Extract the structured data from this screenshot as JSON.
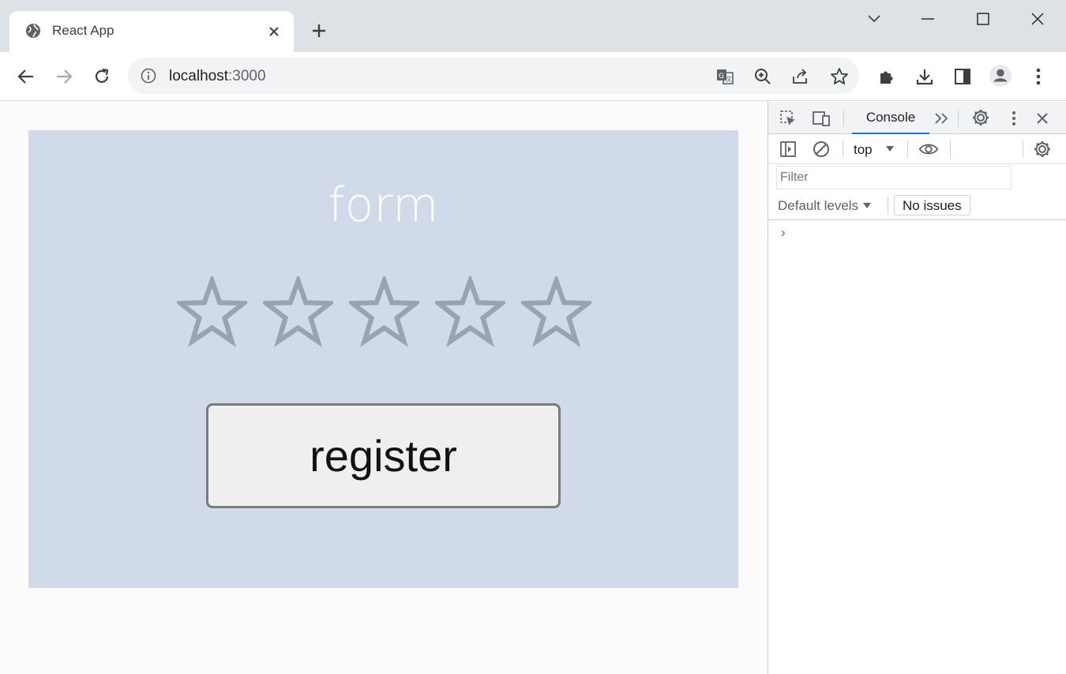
{
  "browser": {
    "tab_title": "React App",
    "url_host": "localhost",
    "url_port": ":3000"
  },
  "page": {
    "form_title": "form",
    "stars": [
      "star-1",
      "star-2",
      "star-3",
      "star-4",
      "star-5"
    ],
    "rating": 0,
    "rating_max": 5,
    "register_label": "register"
  },
  "devtools": {
    "console_tab": "Console",
    "context": "top",
    "filter_placeholder": "Filter",
    "levels": "Default levels",
    "issues": "No issues",
    "prompt": "›"
  },
  "colors": {
    "panel_bg": "#d0dae8",
    "star_stroke": "#9aa3b2",
    "accent": "#1a73e8"
  }
}
